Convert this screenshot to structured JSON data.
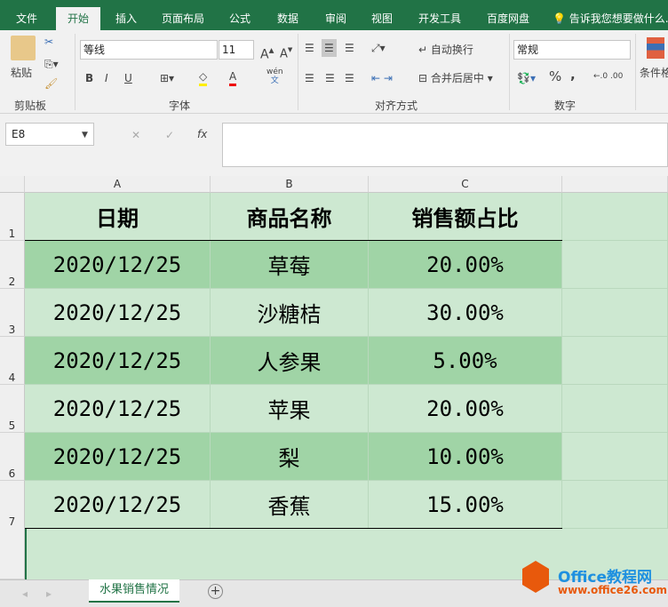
{
  "ribbon_tabs": [
    "文件",
    "开始",
    "插入",
    "页面布局",
    "公式",
    "数据",
    "审阅",
    "视图",
    "开发工具",
    "百度网盘"
  ],
  "active_tab": "开始",
  "tell_me": "告诉我您想要做什么...",
  "clipboard": {
    "paste": "粘贴",
    "label": "剪贴板"
  },
  "font": {
    "name": "等线",
    "size": "11",
    "label": "字体",
    "bold": "B",
    "italic": "I",
    "underline": "U",
    "phonetic_top": "wén",
    "phonetic_bottom": "文"
  },
  "alignment": {
    "wrap": "自动换行",
    "merge": "合并后居中",
    "label": "对齐方式"
  },
  "number": {
    "format": "常规",
    "percent": "%",
    "comma": ",",
    "label": "数字"
  },
  "styles": {
    "conditional": "条件格"
  },
  "formula_bar": {
    "name_box": "E8",
    "fx": "fx",
    "value": ""
  },
  "columns": [
    "A",
    "B",
    "C"
  ],
  "rows": [
    {
      "num": "1",
      "cells": [
        "日期",
        "商品名称",
        "销售额占比"
      ]
    },
    {
      "num": "2",
      "cells": [
        "2020/12/25",
        "草莓",
        "20.00%"
      ]
    },
    {
      "num": "3",
      "cells": [
        "2020/12/25",
        "沙糖桔",
        "30.00%"
      ]
    },
    {
      "num": "4",
      "cells": [
        "2020/12/25",
        "人参果",
        "5.00%"
      ]
    },
    {
      "num": "5",
      "cells": [
        "2020/12/25",
        "苹果",
        "20.00%"
      ]
    },
    {
      "num": "6",
      "cells": [
        "2020/12/25",
        "梨",
        "10.00%"
      ]
    },
    {
      "num": "7",
      "cells": [
        "2020/12/25",
        "香蕉",
        "15.00%"
      ]
    }
  ],
  "sheet_tab": "水果销售情况",
  "watermark": {
    "title": "Office教程网",
    "url": "www.office26.com"
  },
  "colors": {
    "green": "#217346",
    "cell": "#cde8d1",
    "band": "#a0d4a6"
  }
}
